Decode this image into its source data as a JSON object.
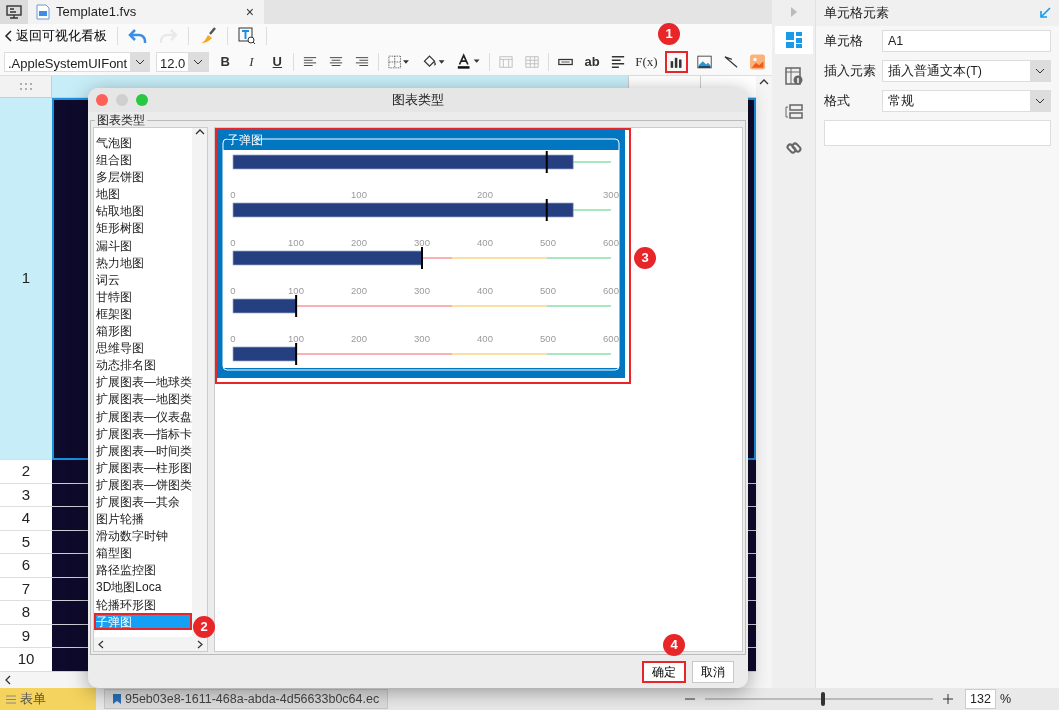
{
  "tabs": [
    {
      "title": "Template1.fvs",
      "close": "×",
      "selected": true
    }
  ],
  "toolbar": {
    "back": "返回可视化看板",
    "tools": [
      {
        "kind": "undo",
        "disabled": false
      },
      {
        "kind": "redo",
        "disabled": true
      },
      {
        "kind": "brush",
        "disabled": false
      },
      {
        "kind": "preview",
        "disabled": false
      }
    ]
  },
  "format_bar": {
    "font": ".AppleSystemUIFont",
    "size": "12.0",
    "tools": [
      {
        "kind": "bold",
        "text": "B",
        "highlighted": false
      },
      {
        "kind": "italic",
        "text": "I",
        "highlighted": false
      },
      {
        "kind": "underline",
        "text": "U",
        "highlighted": false
      },
      {
        "kind": "align-left",
        "highlighted": false
      },
      {
        "kind": "align-center",
        "highlighted": false
      },
      {
        "kind": "align-right",
        "highlighted": false
      },
      {
        "kind": "border",
        "highlighted": false
      },
      {
        "kind": "fill",
        "highlighted": false
      },
      {
        "kind": "font-color",
        "highlighted": false
      },
      {
        "kind": "merge",
        "highlighted": false
      },
      {
        "kind": "grid",
        "highlighted": false
      },
      {
        "kind": "input",
        "highlighted": false
      },
      {
        "kind": "ab",
        "text": "ab",
        "highlighted": false
      },
      {
        "kind": "wrap",
        "highlighted": false
      },
      {
        "kind": "formula",
        "text": "F(x)",
        "highlighted": false
      },
      {
        "kind": "chart",
        "highlighted": true
      },
      {
        "kind": "image",
        "highlighted": false
      },
      {
        "kind": "slash",
        "highlighted": false
      },
      {
        "kind": "picture",
        "highlighted": false
      }
    ]
  },
  "sheet": {
    "rows": [
      {
        "label": "1",
        "selected": true
      },
      {
        "label": "2",
        "selected": false
      },
      {
        "label": "3",
        "selected": false
      },
      {
        "label": "4",
        "selected": false
      },
      {
        "label": "5",
        "selected": false
      },
      {
        "label": "6",
        "selected": false
      },
      {
        "label": "7",
        "selected": false
      },
      {
        "label": "8",
        "selected": false
      },
      {
        "label": "9",
        "selected": false
      },
      {
        "label": "10",
        "selected": false
      }
    ]
  },
  "side_tabs": [
    {
      "kind": "cell",
      "selected": true
    },
    {
      "kind": "attributes",
      "selected": false
    },
    {
      "kind": "widget",
      "selected": false
    },
    {
      "kind": "link",
      "selected": false
    }
  ],
  "properties": {
    "title": "单元格元素",
    "fields": [
      {
        "kind": "text",
        "label": "单元格",
        "value": "A1"
      },
      {
        "kind": "select",
        "label": "插入元素",
        "value": "插入普通文本(T)"
      },
      {
        "kind": "select",
        "label": "格式",
        "value": "常规"
      },
      {
        "kind": "area"
      }
    ]
  },
  "dialog": {
    "title": "图表类型",
    "group": "图表类型",
    "items": [
      {
        "label": "气泡图",
        "selected": false
      },
      {
        "label": "组合图",
        "selected": false
      },
      {
        "label": "多层饼图",
        "selected": false
      },
      {
        "label": "地图",
        "selected": false
      },
      {
        "label": "钻取地图",
        "selected": false
      },
      {
        "label": "矩形树图",
        "selected": false
      },
      {
        "label": "漏斗图",
        "selected": false
      },
      {
        "label": "热力地图",
        "selected": false
      },
      {
        "label": "词云",
        "selected": false
      },
      {
        "label": "甘特图",
        "selected": false
      },
      {
        "label": "框架图",
        "selected": false
      },
      {
        "label": "箱形图",
        "selected": false
      },
      {
        "label": "思维导图",
        "selected": false
      },
      {
        "label": "动态排名图",
        "selected": false
      },
      {
        "label": "扩展图表—地球类",
        "selected": false
      },
      {
        "label": "扩展图表—地图类",
        "selected": false
      },
      {
        "label": "扩展图表—仪表盘",
        "selected": false
      },
      {
        "label": "扩展图表—指标卡",
        "selected": false
      },
      {
        "label": "扩展图表—时间类",
        "selected": false
      },
      {
        "label": "扩展图表—柱形图",
        "selected": false
      },
      {
        "label": "扩展图表—饼图类",
        "selected": false
      },
      {
        "label": "扩展图表—其余",
        "selected": false
      },
      {
        "label": "图片轮播",
        "selected": false
      },
      {
        "label": "滑动数字时钟",
        "selected": false
      },
      {
        "label": "箱型图",
        "selected": false
      },
      {
        "label": "路径监控图",
        "selected": false
      },
      {
        "label": "3D地图Loca",
        "selected": false
      },
      {
        "label": "轮播环形图",
        "selected": false
      },
      {
        "label": "子弹图",
        "selected": true
      }
    ],
    "preview": {
      "title": "子弹图",
      "highlighted": true,
      "rows": [
        {
          "kind": "bullet"
        },
        {
          "kind": "bullet",
          "ticks": [
            "0",
            "100",
            "200",
            "300"
          ]
        },
        {
          "kind": "bullet",
          "ticks": [
            "0",
            "100",
            "200",
            "300",
            "400",
            "500",
            "600"
          ]
        },
        {
          "kind": "bullet",
          "ticks": [
            "0",
            "100",
            "200",
            "300",
            "400",
            "500",
            "600"
          ]
        },
        {
          "kind": "bullet",
          "ticks": [
            "0",
            "100",
            "200",
            "300",
            "400",
            "500",
            "600"
          ]
        }
      ]
    },
    "buttons": [
      {
        "label": "确定",
        "highlighted": true
      },
      {
        "label": "取消",
        "highlighted": false
      }
    ]
  },
  "badges": [
    {
      "text": "1"
    },
    {
      "text": "2"
    },
    {
      "text": "3"
    },
    {
      "text": "4"
    }
  ],
  "status_bar": {
    "sheet": "表单",
    "file": "95eb03e8-1611-468a-abda-4d56633b0c64.ec",
    "zoom": {
      "level": 0.51
    },
    "zoom_value": "132",
    "percent": "%"
  }
}
